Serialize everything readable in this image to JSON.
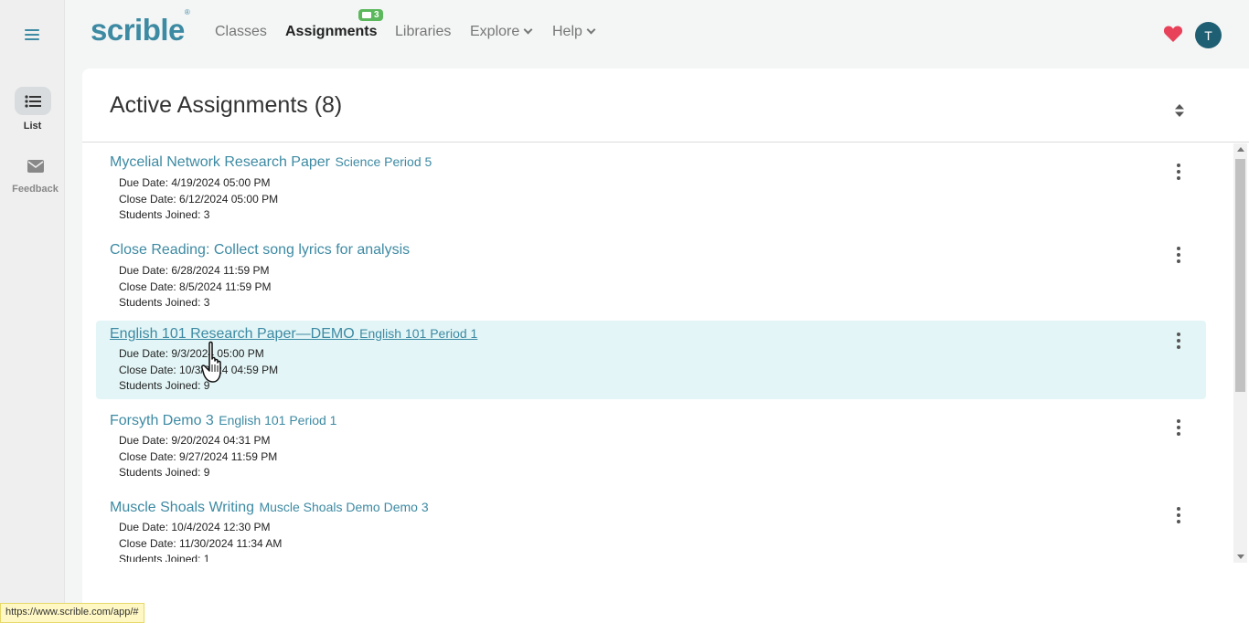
{
  "sidebar": {
    "items": [
      {
        "label": "List",
        "icon": "list-icon"
      },
      {
        "label": "Feedback",
        "icon": "envelope-icon"
      }
    ]
  },
  "header": {
    "logo": "scrible",
    "logo_mark": "®",
    "nav": [
      {
        "label": "Classes"
      },
      {
        "label": "Assignments"
      },
      {
        "label": "Libraries"
      },
      {
        "label": "Explore"
      },
      {
        "label": "Help"
      }
    ],
    "assignments_badge": "3",
    "user_initial": "T"
  },
  "main": {
    "title": "Active Assignments (8)",
    "assignments": [
      {
        "title": "Mycelial Network Research Paper",
        "class": "Science Period 5",
        "due": "Due Date: 4/19/2024 05:00 PM",
        "close": "Close Date: 6/12/2024 05:00 PM",
        "students": "Students Joined: 3"
      },
      {
        "title": "Close Reading: Collect song lyrics for analysis",
        "class": "",
        "due": "Due Date: 6/28/2024 11:59 PM",
        "close": "Close Date: 8/5/2024 11:59 PM",
        "students": "Students Joined: 3"
      },
      {
        "title": "English 101 Research Paper—DEMO",
        "class": "English 101 Period 1",
        "due": "Due Date: 9/3/2024 05:00 PM",
        "close": "Close Date: 10/3/2024 04:59 PM",
        "students": "Students Joined: 9"
      },
      {
        "title": "Forsyth Demo 3",
        "class": "English 101 Period 1",
        "due": "Due Date: 9/20/2024 04:31 PM",
        "close": "Close Date: 9/27/2024 11:59 PM",
        "students": "Students Joined: 9"
      },
      {
        "title": "Muscle Shoals Writing",
        "class": "Muscle Shoals Demo Demo 3",
        "due": "Due Date: 10/4/2024 12:30 PM",
        "close": "Close Date: 11/30/2024 11:34 AM",
        "students": "Students Joined: 1"
      }
    ]
  },
  "status_bar": {
    "url": "https://www.scrible.com/app/#"
  },
  "colors": {
    "brand": "#3d8aa3",
    "highlight": "#e3f5f6",
    "badge": "#5cb85c",
    "heart": "#e8425a",
    "avatar": "#1f5f73"
  }
}
